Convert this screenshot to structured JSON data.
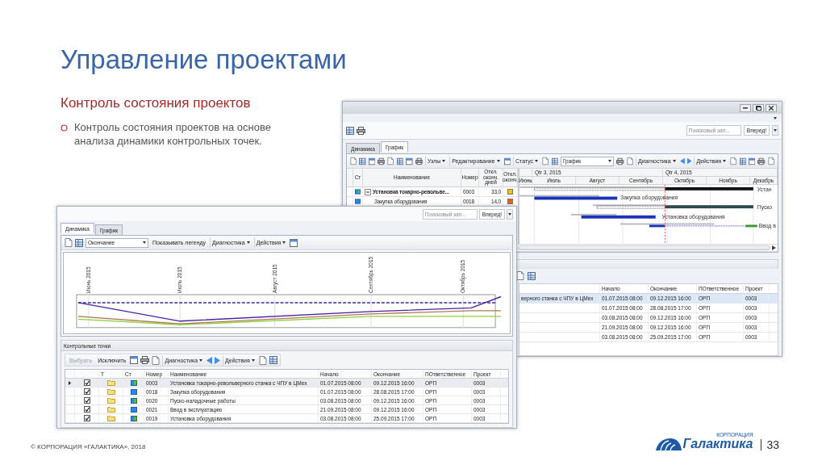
{
  "slide": {
    "title": "Управление проектами",
    "subtitle": "Контроль состояния проектов",
    "bullets": [
      "Контроль состояния проектов на основе анализа динамики контрольных точек."
    ],
    "footer": "© КОРПОРАЦИЯ «ГАЛАКТИКА», 2018",
    "logo": {
      "caption": "КОРПОРАЦИЯ",
      "name": "Галактика"
    },
    "page_number": "33"
  },
  "back_window": {
    "search": {
      "placeholder": "Поисковый зап...",
      "button": "Вперед!"
    },
    "tabs": [
      {
        "label": "Динамика",
        "selected": false
      },
      {
        "label": "График",
        "selected": true
      }
    ],
    "toolbar": [
      {
        "kind": "icon"
      },
      {
        "kind": "icon"
      },
      {
        "kind": "icon"
      },
      {
        "kind": "icon"
      },
      {
        "kind": "icon"
      },
      {
        "kind": "icon"
      },
      {
        "kind": "icon"
      },
      {
        "kind": "icon"
      },
      {
        "kind": "menu",
        "label": "Узлы"
      },
      {
        "kind": "menu",
        "label": "Редактирование"
      },
      {
        "kind": "icon"
      },
      {
        "kind": "menu",
        "label": "Статус"
      },
      {
        "kind": "icon"
      },
      {
        "kind": "icon"
      },
      {
        "kind": "select",
        "value": "График"
      },
      {
        "kind": "icon"
      },
      {
        "kind": "icon"
      },
      {
        "kind": "menu",
        "label": "Диагностика"
      },
      {
        "kind": "nav"
      },
      {
        "kind": "menu",
        "label": "Действия"
      },
      {
        "kind": "icon"
      },
      {
        "kind": "icon"
      },
      {
        "kind": "icon"
      },
      {
        "kind": "icon"
      },
      {
        "kind": "icon"
      }
    ],
    "grid": {
      "columns": [
        "Ст",
        "Наименование",
        "Номер",
        "Откл. оконч. дней",
        "Откл. оконч."
      ],
      "rows": [
        {
          "name": "Установка токарно-револьве...",
          "number": "0003",
          "deviation": "33,0",
          "color": "#e8c81a",
          "expanded": true,
          "children": [
            {
              "name": "Закупка оборудования",
              "number": "0018",
              "deviation": "14,0",
              "color": "#e0642a"
            }
          ]
        }
      ]
    },
    "gantt": {
      "quarters": [
        "Qtr 3, 2015",
        "Qtr 4, 2015"
      ],
      "months": [
        "Июнь",
        "Июль",
        "Август",
        "Сентябрь",
        "Октябрь",
        "Ноябрь",
        "Декабрь"
      ],
      "bar_labels": [
        "Устан",
        "Закупка оборудования",
        "Пуско",
        "Установка оборудования",
        "Ввод в"
      ]
    },
    "details": {
      "toolbar": [
        {
          "kind": "icon"
        },
        {
          "kind": "icon"
        }
      ],
      "columns": [
        "Начало",
        "Окончание",
        "ПОтветственное",
        "Проект"
      ],
      "rows": [
        {
          "name": "верного станка с ЧПУ в ЦМех",
          "start": "01.07.2015 08:00",
          "end": "09.12.2015 16:00",
          "owner": "ОРП",
          "project": "0003",
          "selected": true
        },
        {
          "start": "01.07.2015 08:00",
          "end": "28.08.2015 17:00",
          "owner": "ОРП",
          "project": "0003",
          "selected": false
        },
        {
          "start": "03.08.2015 08:00",
          "end": "09.12.2015 16:00",
          "owner": "ОРП",
          "project": "0003",
          "selected": false
        },
        {
          "start": "21.09.2015 08:00",
          "end": "09.12.2015 16:00",
          "owner": "ОРП",
          "project": "0003",
          "selected": false
        },
        {
          "start": "03.08.2015 08:00",
          "end": "25.09.2015 17:00",
          "owner": "ОРП",
          "project": "0003",
          "selected": false
        }
      ]
    }
  },
  "front_window": {
    "search": {
      "placeholder": "Поисковый зап...",
      "button": "Вперед!"
    },
    "tabs": [
      {
        "label": "Динамика",
        "selected": true
      },
      {
        "label": "График",
        "selected": false
      }
    ],
    "toolbar": [
      {
        "kind": "icon"
      },
      {
        "kind": "icon"
      },
      {
        "kind": "select",
        "value": "Окончание"
      },
      {
        "kind": "button",
        "label": "Показывать легенду",
        "disabled": false
      },
      {
        "kind": "menu",
        "label": "Диагностика"
      },
      {
        "kind": "menu",
        "label": "Действия"
      },
      {
        "kind": "icon"
      }
    ],
    "chart": {
      "months": [
        "Июнь 2015",
        "Июль 2015",
        "Август 2015",
        "Сентябрь 2015",
        "Октябрь 2015"
      ]
    },
    "checkpoints": {
      "title": "Контрольные точки",
      "toolbar": [
        {
          "kind": "button",
          "label": "Выбрать",
          "disabled": true
        },
        {
          "kind": "button",
          "label": "Исключить",
          "disabled": false
        },
        {
          "kind": "icon"
        },
        {
          "kind": "icon"
        },
        {
          "kind": "icon"
        },
        {
          "kind": "menu",
          "label": "Диагностика"
        },
        {
          "kind": "nav"
        },
        {
          "kind": "menu",
          "label": "Действия"
        },
        {
          "kind": "icon"
        },
        {
          "kind": "icon"
        }
      ],
      "columns": [
        "Т",
        "Ст",
        "Номер",
        "Наименование",
        "Начало",
        "Окончание",
        "ПОтветственное",
        "Проект"
      ],
      "rows": [
        {
          "selected": true,
          "checked": true,
          "number": "0003",
          "name": "Установка токарно-револьверного станка с ЧПУ в ЦМех",
          "start": "01.07.2015 08:00",
          "end": "09.12.2015 16:00",
          "owner": "ОРП",
          "project": "0003"
        },
        {
          "selected": false,
          "checked": true,
          "number": "0018",
          "name": "Закупка оборудования",
          "start": "01.07.2015 08:00",
          "end": "28.08.2015 17:00",
          "owner": "ОРП",
          "project": "0003"
        },
        {
          "selected": false,
          "checked": true,
          "number": "0020",
          "name": "Пуско-наладочные работы",
          "start": "03.08.2015 08:00",
          "end": "09.12.2015 16:00",
          "owner": "ОРП",
          "project": "0003"
        },
        {
          "selected": false,
          "checked": true,
          "number": "0021",
          "name": "Ввод в эксплуатацию",
          "start": "21.09.2015 08:00",
          "end": "09.12.2015 16:00",
          "owner": "ОРП",
          "project": "0003"
        },
        {
          "selected": false,
          "checked": true,
          "number": "0019",
          "name": "Установка оборудования",
          "start": "03.08.2015 08:00",
          "end": "25.09.2015 17:00",
          "owner": "ОРП",
          "project": "0003"
        }
      ]
    }
  }
}
